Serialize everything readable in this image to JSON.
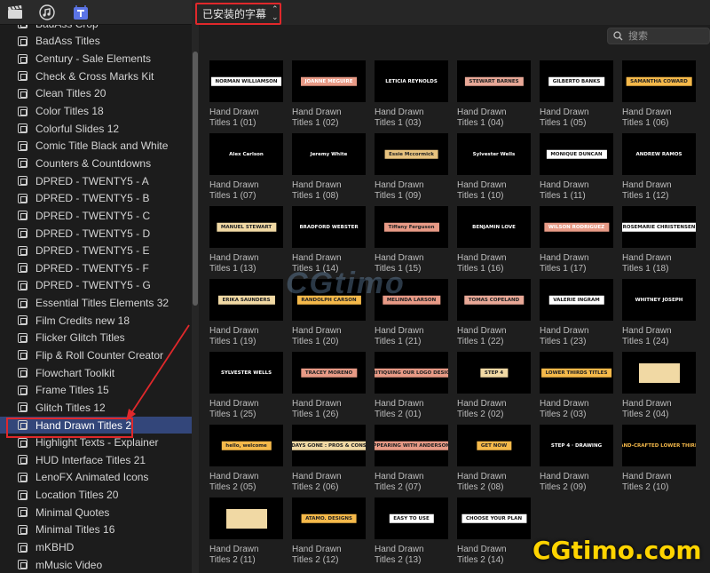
{
  "toolbar": {
    "buttons": [
      "clapper-icon",
      "music-icon",
      "titles-icon"
    ],
    "library_selector": "已安装的字幕",
    "search_placeholder": "搜索"
  },
  "sidebar": {
    "items": [
      "BadAss Crop",
      "BadAss Titles",
      "Century - Sale Elements",
      "Check & Cross Marks Kit",
      "Clean Titles 20",
      "Color Titles 18",
      "Colorful Slides 12",
      "Comic Title Black and White",
      "Counters & Countdowns",
      "DPRED - TWENTY5 - A",
      "DPRED - TWENTY5 - B",
      "DPRED - TWENTY5 - C",
      "DPRED - TWENTY5 - D",
      "DPRED - TWENTY5 - E",
      "DPRED - TWENTY5 - F",
      "DPRED - TWENTY5 - G",
      "Essential Titles Elements 32",
      "Film Credits new 18",
      "Flicker Glitch Titles",
      "Flip & Roll Counter Creator",
      "Flowchart Toolkit",
      "Frame Titles 15",
      "Glitch Titles 12",
      "Hand Drawn Titles 2",
      "Highlight Texts - Explainer",
      "HUD Interface Titles 21",
      "LenoFX Animated Icons",
      "Location Titles 20",
      "Minimal Quotes",
      "Minimal Titles 16",
      "mKBHD",
      "mMusic Video"
    ],
    "selected_index": 23
  },
  "tiles": [
    {
      "line1": "Hand Drawn",
      "line2": "Titles 1 (01)",
      "thumb": "NORMAN WILLIAMSON",
      "bg": "#ffffff",
      "fg": "#111111"
    },
    {
      "line1": "Hand Drawn",
      "line2": "Titles 1 (02)",
      "thumb": "JOANNE MEGUIRE",
      "bg": "#e89a86",
      "fg": "#ffffff"
    },
    {
      "line1": "Hand Drawn",
      "line2": "Titles 1 (03)",
      "thumb": "LETICIA REYNOLDS",
      "bg": "#000000",
      "fg": "#ffffff"
    },
    {
      "line1": "Hand Drawn",
      "line2": "Titles 1 (04)",
      "thumb": "STEWART BARNES",
      "bg": "#e8a897",
      "fg": "#222222"
    },
    {
      "line1": "Hand Drawn",
      "line2": "Titles 1 (05)",
      "thumb": "GILBERTO BANKS",
      "bg": "#ffffff",
      "fg": "#111111"
    },
    {
      "line1": "Hand Drawn",
      "line2": "Titles 1 (06)",
      "thumb": "SAMANTHA COWARD",
      "bg": "#f5b94a",
      "fg": "#222222"
    },
    {
      "line1": "Hand Drawn",
      "line2": "Titles 1 (07)",
      "thumb": "Alex Carlson",
      "bg": "#000000",
      "fg": "#ffffff"
    },
    {
      "line1": "Hand Drawn",
      "line2": "Titles 1 (08)",
      "thumb": "Jeremy White",
      "bg": "#000000",
      "fg": "#ffffff"
    },
    {
      "line1": "Hand Drawn",
      "line2": "Titles 1 (09)",
      "thumb": "Essie Mccormick",
      "bg": "#e8c37f",
      "fg": "#222222"
    },
    {
      "line1": "Hand Drawn",
      "line2": "Titles 1 (10)",
      "thumb": "Sylvester Wells",
      "bg": "#000000",
      "fg": "#ffffff"
    },
    {
      "line1": "Hand Drawn",
      "line2": "Titles 1 (11)",
      "thumb": "MONIQUE DUNCAN",
      "bg": "#ffffff",
      "fg": "#111111"
    },
    {
      "line1": "Hand Drawn",
      "line2": "Titles 1 (12)",
      "thumb": "ANDREW RAMOS",
      "bg": "#000000",
      "fg": "#ffffff"
    },
    {
      "line1": "Hand Drawn",
      "line2": "Titles 1 (13)",
      "thumb": "MANUEL STEWART",
      "bg": "#f1d9a4",
      "fg": "#222222"
    },
    {
      "line1": "Hand Drawn",
      "line2": "Titles 1 (14)",
      "thumb": "BRADFORD WEBSTER",
      "bg": "#000000",
      "fg": "#ffffff"
    },
    {
      "line1": "Hand Drawn",
      "line2": "Titles 1 (15)",
      "thumb": "Tiffany Ferguson",
      "bg": "#e89a86",
      "fg": "#222222"
    },
    {
      "line1": "Hand Drawn",
      "line2": "Titles 1 (16)",
      "thumb": "BENJAMIN LOVE",
      "bg": "#000000",
      "fg": "#ffffff"
    },
    {
      "line1": "Hand Drawn",
      "line2": "Titles 1 (17)",
      "thumb": "WILSON RODRIGUEZ",
      "bg": "#e89a86",
      "fg": "#ffffff"
    },
    {
      "line1": "Hand Drawn",
      "line2": "Titles 1 (18)",
      "thumb": "ROSEMARIE CHRISTENSEN",
      "bg": "#ffffff",
      "fg": "#111111"
    },
    {
      "line1": "Hand Drawn",
      "line2": "Titles 1 (19)",
      "thumb": "ERIKA SAUNDERS",
      "bg": "#f1d9a4",
      "fg": "#222222"
    },
    {
      "line1": "Hand Drawn",
      "line2": "Titles 1 (20)",
      "thumb": "RANDOLPH CARSON",
      "bg": "#f5b94a",
      "fg": "#222222"
    },
    {
      "line1": "Hand Drawn",
      "line2": "Titles 1 (21)",
      "thumb": "MELINDA LARSON",
      "bg": "#e89a86",
      "fg": "#222222"
    },
    {
      "line1": "Hand Drawn",
      "line2": "Titles 1 (22)",
      "thumb": "TOMAS COPELAND",
      "bg": "#e8a897",
      "fg": "#222222"
    },
    {
      "line1": "Hand Drawn",
      "line2": "Titles 1 (23)",
      "thumb": "VALERIE INGRAM",
      "bg": "#ffffff",
      "fg": "#111111"
    },
    {
      "line1": "Hand Drawn",
      "line2": "Titles 1 (24)",
      "thumb": "WHITNEY JOSEPH",
      "bg": "#000000",
      "fg": "#ffffff"
    },
    {
      "line1": "Hand Drawn",
      "line2": "Titles 1 (25)",
      "thumb": "SYLVESTER WELLS",
      "bg": "#000000",
      "fg": "#ffffff"
    },
    {
      "line1": "Hand Drawn",
      "line2": "Titles 1 (26)",
      "thumb": "TRACEY MORENO",
      "bg": "#e89a86",
      "fg": "#222222"
    },
    {
      "line1": "Hand Drawn",
      "line2": "Titles 2 (01)",
      "thumb": "CRITIQUING OUR LOGO DESIGN",
      "bg": "#e89a86",
      "fg": "#222222"
    },
    {
      "line1": "Hand Drawn",
      "line2": "Titles 2 (02)",
      "thumb": "STEP 4",
      "bg": "#f1d9a4",
      "fg": "#222222"
    },
    {
      "line1": "Hand Drawn",
      "line2": "Titles 2 (03)",
      "thumb": "LOWER THIRDS TITLES",
      "bg": "#f5b94a",
      "fg": "#222222"
    },
    {
      "line1": "Hand Drawn",
      "line2": "Titles 2 (04)",
      "thumb": "",
      "bg": "#f1d9a4",
      "fg": "#222222"
    },
    {
      "line1": "Hand Drawn",
      "line2": "Titles 2 (05)",
      "thumb": "hello, welcome",
      "bg": "#f5b94a",
      "fg": "#222222"
    },
    {
      "line1": "Hand Drawn",
      "line2": "Titles 2 (06)",
      "thumb": "DAYS GONE : PROS & CONS",
      "bg": "#f1d9a4",
      "fg": "#222222"
    },
    {
      "line1": "Hand Drawn",
      "line2": "Titles 2 (07)",
      "thumb": "APPEARING WITH ANDERSONS",
      "bg": "#e89a86",
      "fg": "#222222"
    },
    {
      "line1": "Hand Drawn",
      "line2": "Titles 2 (08)",
      "thumb": "GET NOW",
      "bg": "#f5b94a",
      "fg": "#222222"
    },
    {
      "line1": "Hand Drawn",
      "line2": "Titles 2 (09)",
      "thumb": "STEP 4 · DRAWING",
      "bg": "#000000",
      "fg": "#ffffff"
    },
    {
      "line1": "Hand Drawn",
      "line2": "Titles 2 (10)",
      "thumb": "HAND-CRAFTED LOWER THIRDS",
      "bg": "#000000",
      "fg": "#f5b94a"
    },
    {
      "line1": "Hand Drawn",
      "line2": "Titles 2 (11)",
      "thumb": "",
      "bg": "#f1d9a4",
      "fg": "#222222"
    },
    {
      "line1": "Hand Drawn",
      "line2": "Titles 2 (12)",
      "thumb": "ATAMO. DESIGNS",
      "bg": "#f5b94a",
      "fg": "#222222"
    },
    {
      "line1": "Hand Drawn",
      "line2": "Titles 2 (13)",
      "thumb": "EASY TO USE",
      "bg": "#ffffff",
      "fg": "#111111"
    },
    {
      "line1": "Hand Drawn",
      "line2": "Titles 2 (14)",
      "thumb": "CHOOSE YOUR PLAN",
      "bg": "#ffffff",
      "fg": "#111111"
    }
  ],
  "watermark": {
    "center": "CGtimo",
    "corner": "CGtimo.com"
  },
  "colors": {
    "selection": "#33467a",
    "highlight_red": "#e0282b",
    "toolbar_titles_icon": "#5b74e6"
  }
}
